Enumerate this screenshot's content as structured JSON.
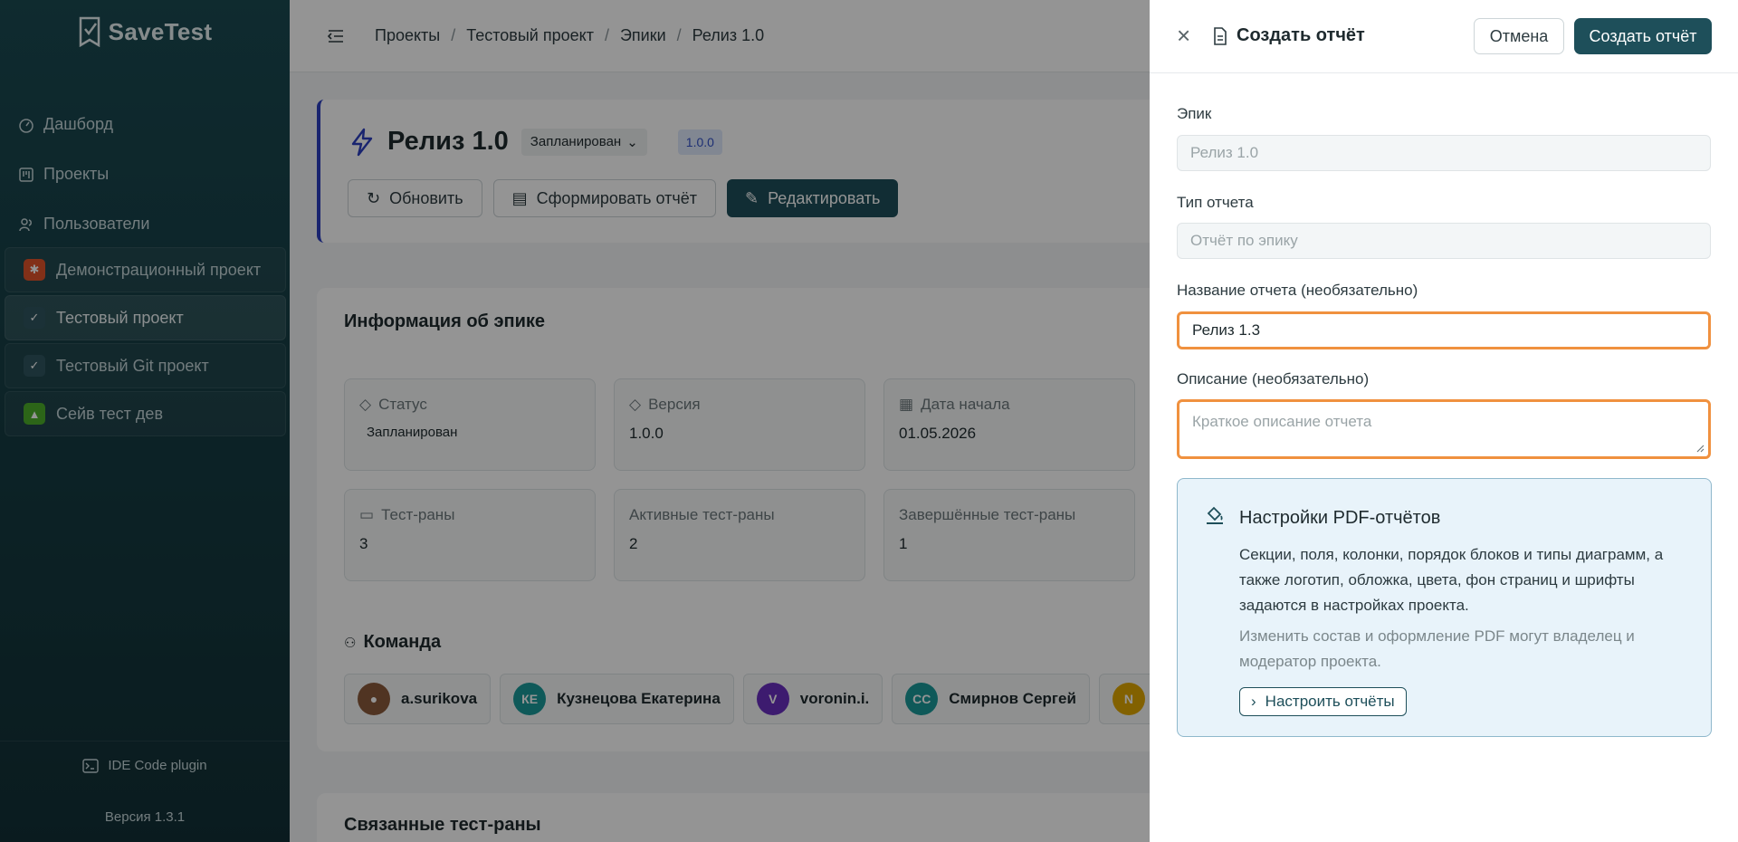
{
  "app": {
    "name": "SaveTest",
    "version_label": "Версия 1.3.1",
    "plugin_label": "IDE Code plugin"
  },
  "nav": {
    "items": [
      {
        "label": "Дашборд",
        "icon": "dashboard-icon"
      },
      {
        "label": "Проекты",
        "icon": "projects-icon"
      },
      {
        "label": "Пользователи",
        "icon": "users-icon"
      }
    ]
  },
  "projects": [
    {
      "label": "Демонстрационный проект",
      "color": "#e0532a"
    },
    {
      "label": "Тестовый проект",
      "color": "#2f5560"
    },
    {
      "label": "Тестовый Git проект",
      "color": "#2f5560"
    },
    {
      "label": "Сейв тест дев",
      "color": "#4caf2a"
    }
  ],
  "breadcrumb": [
    "Проекты",
    "Тестовый проект",
    "Эпики",
    "Релиз 1.0"
  ],
  "epic": {
    "title": "Релиз 1.0",
    "status": "Запланирован",
    "version": "1.0.0",
    "actions": {
      "refresh": "Обновить",
      "report": "Сформировать отчёт",
      "edit": "Редактировать"
    }
  },
  "info": {
    "title": "Информация об эпике",
    "tiles": [
      {
        "label": "Статус",
        "value": "Запланирован"
      },
      {
        "label": "Версия",
        "value": "1.0.0"
      },
      {
        "label": "Дата начала",
        "value": "01.05.2026"
      },
      {
        "label": "Тест-раны",
        "value": "3"
      },
      {
        "label": "Активные тест-раны",
        "value": "2"
      },
      {
        "label": "Завершённые тест-раны",
        "value": "1"
      }
    ],
    "team_title": "Команда",
    "team": [
      {
        "name": "a.surikova",
        "initials": "",
        "color": "#8a5a3c"
      },
      {
        "name": "Кузнецова Екатерина",
        "initials": "КЕ",
        "color": "#1a9a9a"
      },
      {
        "name": "voronin.i.",
        "initials": "V",
        "color": "#6a2fc0"
      },
      {
        "name": "Смирнов Сергей",
        "initials": "СС",
        "color": "#1a9a9a"
      },
      {
        "name": "",
        "initials": "N",
        "color": "#e0a800"
      }
    ],
    "linked_title": "Связанные тест-раны"
  },
  "drawer": {
    "title": "Создать отчёт",
    "cancel": "Отмена",
    "create": "Создать отчёт",
    "epic_label": "Эпик",
    "epic_value": "Релиз 1.0",
    "type_label": "Тип отчета",
    "type_value": "Отчёт по эпику",
    "name_label": "Название отчета (необязательно)",
    "name_value": "Релиз 1.3",
    "desc_label": "Описание (необязательно)",
    "desc_placeholder": "Краткое описание отчета",
    "pdf": {
      "title": "Настройки PDF-отчётов",
      "text": "Секции, поля, колонки, порядок блоков и типы диаграмм, а также логотип, обложка, цвета, фон страниц и шрифты задаются в настройках проекта.",
      "muted": "Изменить состав и оформление PDF могут владелец и модератор проекта.",
      "button": "Настроить отчёты"
    }
  }
}
